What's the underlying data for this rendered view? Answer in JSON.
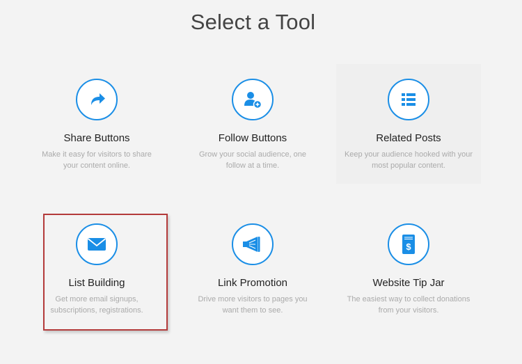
{
  "header": {
    "title": "Select a Tool"
  },
  "accent_color": "#1a8ee6",
  "highlight_color": "#b33a3a",
  "tools": [
    {
      "name": "Share Buttons",
      "desc": "Make it easy for visitors to share your content online.",
      "icon": "share-arrow-icon"
    },
    {
      "name": "Follow Buttons",
      "desc": "Grow your social audience, one follow at a time.",
      "icon": "add-user-icon"
    },
    {
      "name": "Related Posts",
      "desc": "Keep your audience hooked with your most popular content.",
      "icon": "list-icon"
    },
    {
      "name": "List Building",
      "desc": "Get more email signups, subscriptions, registrations.",
      "icon": "envelope-icon"
    },
    {
      "name": "Link Promotion",
      "desc": "Drive more visitors to pages you want them to see.",
      "icon": "megaphone-icon"
    },
    {
      "name": "Website Tip Jar",
      "desc": "The easiest way to collect donations from your visitors.",
      "icon": "tip-jar-icon"
    }
  ]
}
